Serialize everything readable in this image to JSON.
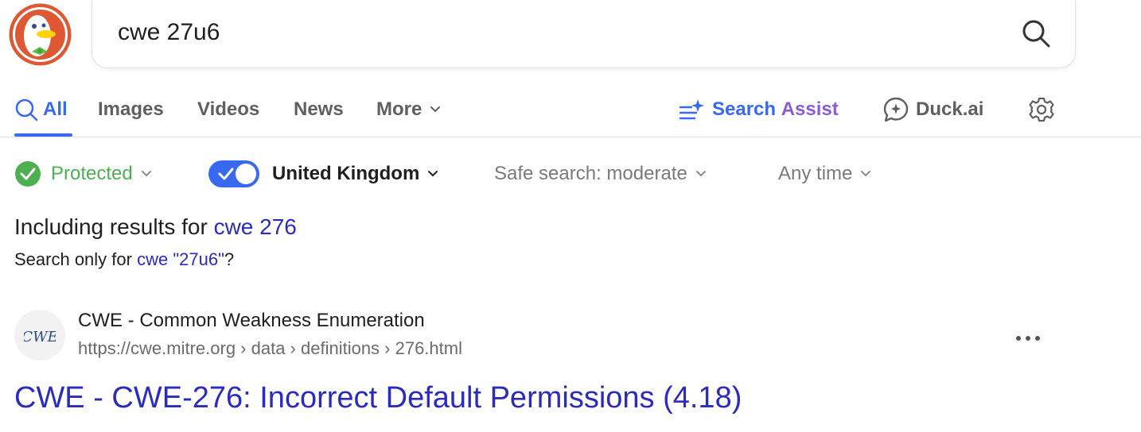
{
  "search": {
    "query": "cwe 27u6"
  },
  "tabs": [
    {
      "label": "All"
    },
    {
      "label": "Images"
    },
    {
      "label": "Videos"
    },
    {
      "label": "News"
    },
    {
      "label": "More"
    }
  ],
  "assist": {
    "part1": "Search ",
    "part2": "Assist"
  },
  "duckai": {
    "label": "Duck.ai"
  },
  "filters": {
    "protected": "Protected",
    "region": "United Kingdom",
    "safe_search": "Safe search: moderate",
    "time": "Any time"
  },
  "correction": {
    "including_prefix": "Including results for ",
    "including_link": "cwe 276",
    "only_prefix": "Search only for ",
    "only_link": "cwe \"27u6\"",
    "only_suffix": "?"
  },
  "result": {
    "site_name": "CWE - Common Weakness Enumeration",
    "url": "https://cwe.mitre.org › data › definitions › 276.html",
    "title": "CWE - CWE-276: Incorrect Default Permissions (4.18)",
    "favicon_text": "CWE"
  },
  "colors": {
    "accent": "#3969ef",
    "link": "#2b2bbf",
    "protected_green": "#4caf50",
    "assist_purple": "#8c5cd6"
  }
}
